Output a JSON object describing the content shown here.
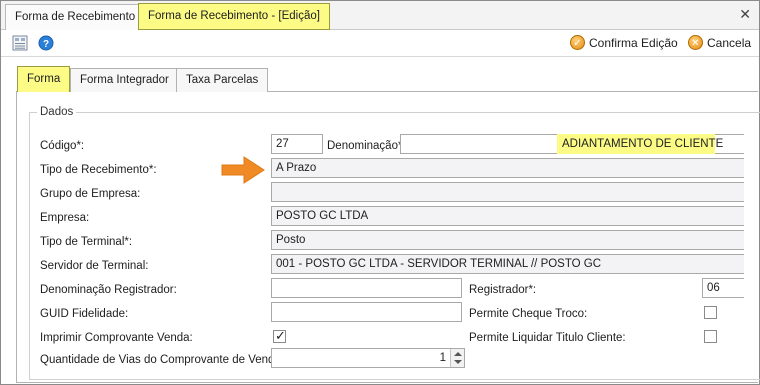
{
  "doc_tabs": [
    {
      "label": "Forma de Recebimento"
    },
    {
      "label": "Forma de Recebimento - [Edição]"
    }
  ],
  "toolbar": {
    "confirm_label": "Confirma Edição",
    "cancel_label": "Cancela"
  },
  "inner_tabs": [
    {
      "label": "Forma"
    },
    {
      "label": "Forma Integrador"
    },
    {
      "label": "Taxa Parcelas"
    }
  ],
  "group": {
    "title": "Dados"
  },
  "form": {
    "codigo": {
      "label": "Código*:",
      "value": "27"
    },
    "denominacao": {
      "label": "Denominação*:",
      "value": "ADIANTAMENTO DE CLIENTE"
    },
    "tipo_recebimento": {
      "label": "Tipo de Recebimento*:",
      "value": "A Prazo"
    },
    "grupo_empresa": {
      "label": "Grupo de Empresa:",
      "value": ""
    },
    "empresa": {
      "label": "Empresa:",
      "value": "POSTO GC LTDA"
    },
    "tipo_terminal": {
      "label": "Tipo de Terminal*:",
      "value": "Posto"
    },
    "servidor_terminal": {
      "label": "Servidor de Terminal:",
      "value": "001 - POSTO GC LTDA - SERVIDOR TERMINAL // POSTO GC"
    },
    "denominacao_registrador": {
      "label": "Denominação Registrador:",
      "value": ""
    },
    "registrador": {
      "label": "Registrador*:",
      "value": "06"
    },
    "guid_fidelidade": {
      "label": "GUID Fidelidade:",
      "value": ""
    },
    "permite_cheque_troco": {
      "label": "Permite Cheque Troco:",
      "checked": false
    },
    "imprimir_comprovante": {
      "label": "Imprimir Comprovante Venda:",
      "checked": true
    },
    "permite_liquidar_titulo": {
      "label": "Permite Liquidar Titulo Cliente:",
      "checked": false
    },
    "quantidade_vias": {
      "label": "Quantidade de Vias do Comprovante de Venda:",
      "value": "1"
    }
  },
  "colors": {
    "highlight": "#fbfb86",
    "arrow": "#f08a24",
    "readonly_field": "#f3f3f6"
  },
  "icons": [
    "report-icon",
    "help-icon",
    "confirm-icon",
    "cancel-icon",
    "arrow-annotation-icon",
    "close-icon"
  ]
}
